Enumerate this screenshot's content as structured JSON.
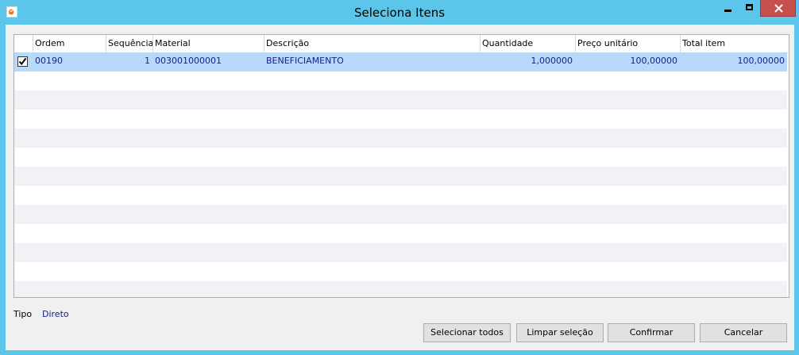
{
  "window": {
    "title": "Seleciona Itens",
    "app_icon": "app-logo-icon"
  },
  "grid": {
    "columns": [
      "Ordem",
      "Sequência",
      "Material",
      "Descrição",
      "Quantidade",
      "Preço unitário",
      "Total item"
    ],
    "rows": [
      {
        "checked": true,
        "ordem": "00190",
        "sequencia": "1",
        "material": "003001000001",
        "descricao": "BENEFICIAMENTO",
        "quantidade": "1,000000",
        "preco_unitario": "100,00000",
        "total_item": "100,00000"
      }
    ]
  },
  "tipo": {
    "label": "Tipo",
    "value": "Direto"
  },
  "buttons": {
    "select_all": "Selecionar todos",
    "clear_selection": "Limpar seleção",
    "confirm": "Confirmar",
    "cancel": "Cancelar"
  },
  "colors": {
    "titlebar": "#5bc6ea",
    "close_button": "#c7504f",
    "selected_row": "#b9d9fb",
    "cell_text": "#17218a"
  }
}
